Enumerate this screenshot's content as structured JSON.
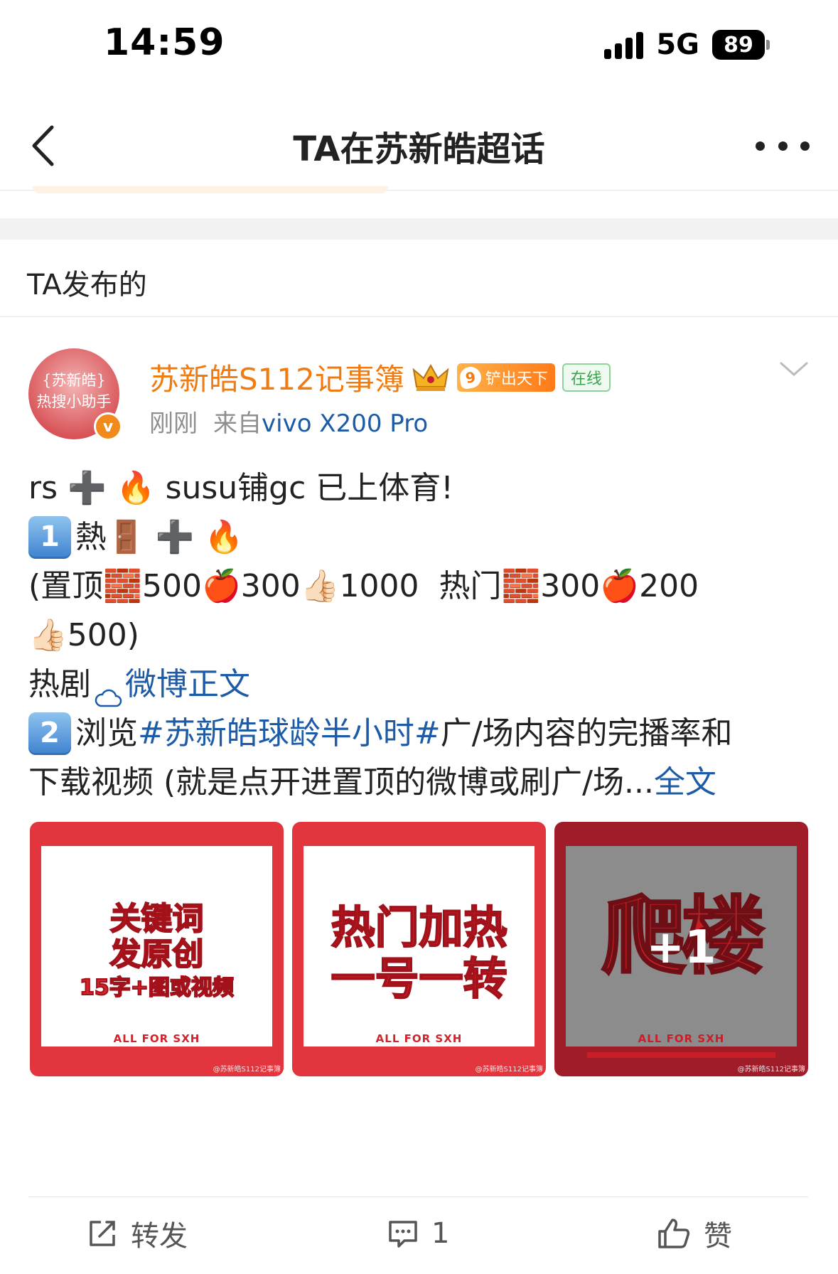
{
  "status_bar": {
    "time": "14:59",
    "network": "5G",
    "battery": "89"
  },
  "nav": {
    "title": "TA在苏新皓超话"
  },
  "section": {
    "title": "TA发布的"
  },
  "post": {
    "avatar_text": [
      "{苏新皓}",
      "热搜小助手"
    ],
    "avatar_badge": "v",
    "username": "苏新皓S112记事簿",
    "level_number": "9",
    "level_label": "铲出天下",
    "online_label": "在线",
    "time": "刚刚",
    "source_prefix": "来自",
    "device": "vivo X200 Pro",
    "lines": {
      "l1_a": "rs",
      "l1_b": "susu铺gc  已上体育!",
      "l2_num": "1",
      "l2_a": "熱",
      "l3_a": "(置顶",
      "l3_b": "500",
      "l3_c": "300",
      "l3_d": "1000",
      "l3_e": "热门",
      "l3_f": "300",
      "l3_g": "200",
      "l4_a": "500)",
      "l5_a": "热剧",
      "l5_link": "微博正文",
      "l6_num": "2",
      "l6_a": "浏览",
      "l6_tag": "#苏新皓球龄半小时#",
      "l6_b": " 广/场内容的完播率和",
      "l7_a": "下载视频 (就是点开进置顶的微博或刷广/场...",
      "l7_more": " 全文"
    },
    "images": [
      {
        "lines": [
          "关键词",
          "发原创",
          "15字+图或视频"
        ],
        "footer": "ALL FOR SXH",
        "watermark": "@苏新皓S112记事簿"
      },
      {
        "lines": [
          "热门加热",
          "一号一转"
        ],
        "footer": "ALL FOR SXH",
        "watermark": "@苏新皓S112记事簿"
      },
      {
        "lines": [
          "爬楼",
          "+1"
        ],
        "footer": "ALL FOR SXH",
        "watermark": "@苏新皓S112记事簿"
      }
    ],
    "actions": {
      "repost": "转发",
      "comment_count": "1",
      "like": "赞"
    }
  }
}
